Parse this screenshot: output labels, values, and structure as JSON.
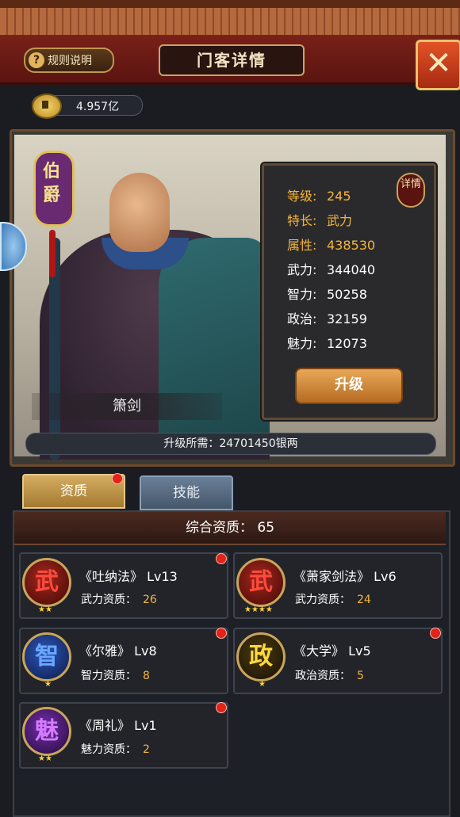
{
  "header": {
    "title": "门客详情",
    "rules_label": "规则说明",
    "close_symbol": "✕"
  },
  "currency": {
    "silver": "4.957亿"
  },
  "hero": {
    "rank": "伯爵",
    "name": "箫剑",
    "detail_badge": "详情",
    "stats": [
      {
        "label": "等级:",
        "value": "245"
      },
      {
        "label": "特长:",
        "value": "武力"
      },
      {
        "label": "属性:",
        "value": "438530"
      },
      {
        "label": "武力:",
        "value": "344040"
      },
      {
        "label": "智力:",
        "value": "50258"
      },
      {
        "label": "政治:",
        "value": "32159"
      },
      {
        "label": "魅力:",
        "value": "12073"
      }
    ],
    "upgrade_label": "升级",
    "upgrade_cost": "升级所需：24701450银两"
  },
  "tabs": {
    "aptitude": "资质",
    "skills": "技能"
  },
  "aptitude": {
    "total": "综合资质：   65",
    "books": [
      {
        "icon": "武",
        "name": "《吐纳法》  Lv13",
        "attr": "武力资质：",
        "value": "26",
        "stars": "★★"
      },
      {
        "icon": "武",
        "name": "《萧家剑法》  Lv6",
        "attr": "武力资质：",
        "value": "24",
        "stars": "★★★★"
      },
      {
        "icon": "智",
        "name": "《尔雅》  Lv8",
        "attr": "智力资质：",
        "value": "8",
        "stars": "★"
      },
      {
        "icon": "政",
        "name": "《大学》  Lv5",
        "attr": "政治资质：",
        "value": "5",
        "stars": "★"
      },
      {
        "icon": "魅",
        "name": "《周礼》  Lv1",
        "attr": "魅力资质：",
        "value": "2",
        "stars": "★★"
      }
    ]
  }
}
